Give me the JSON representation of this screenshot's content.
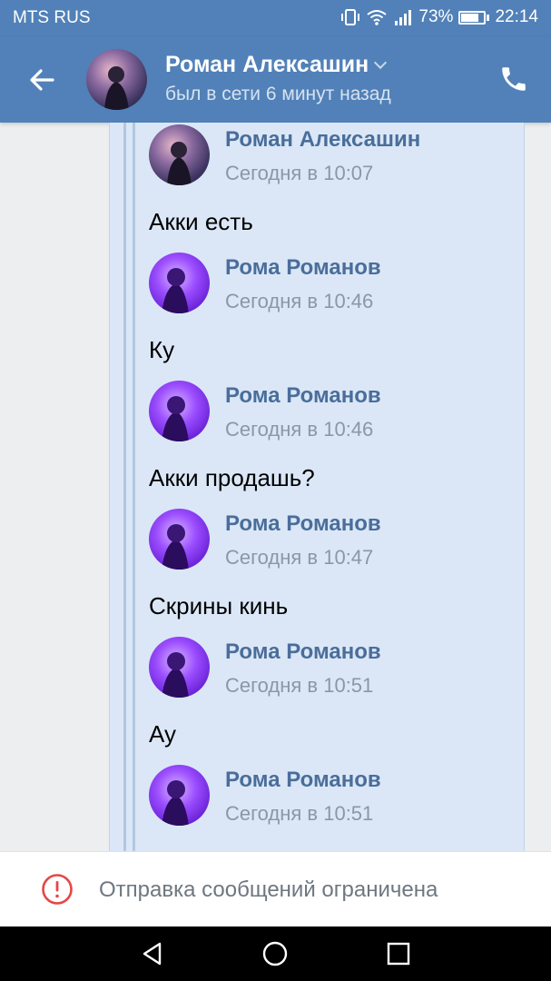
{
  "status_bar": {
    "carrier": "MTS RUS",
    "battery": "73%",
    "time": "22:14"
  },
  "header": {
    "name": "Роман Алексашин",
    "status": "был в сети 6 минут назад"
  },
  "messages": [
    {
      "name": "Роман Алексашин",
      "time": "Сегодня в 10:07",
      "text": "Акки есть"
    },
    {
      "name": "Рома Романов",
      "time": "Сегодня в 10:46",
      "text": "Ку"
    },
    {
      "name": "Рома Романов",
      "time": "Сегодня в 10:46",
      "text": "Акки продашь?"
    },
    {
      "name": "Рома Романов",
      "time": "Сегодня в 10:47",
      "text": "Скрины кинь"
    },
    {
      "name": "Рома Романов",
      "time": "Сегодня в 10:51",
      "text": "Ау"
    },
    {
      "name": "Рома Романов",
      "time": "Сегодня в 10:51",
      "text": ""
    }
  ],
  "restriction": {
    "text": "Отправка сообщений ограничена"
  },
  "colors": {
    "accent": "#5181b8",
    "forwarded_bg": "#dbe7f7",
    "author_name": "#4a6e9a",
    "warning": "#e64646"
  },
  "icons": {
    "back": "arrow-left-icon",
    "call": "phone-icon",
    "warning": "exclamation-circle-icon",
    "nav_back": "triangle-back-icon",
    "nav_home": "circle-home-icon",
    "nav_recent": "square-recent-icon"
  }
}
